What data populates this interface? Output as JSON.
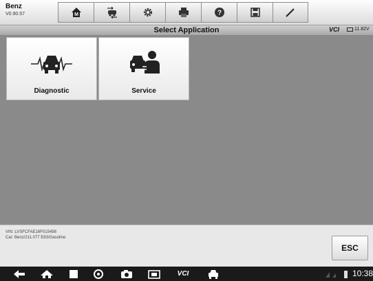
{
  "app": {
    "brand": "Benz",
    "version": "V0.90.57"
  },
  "toolbar": {
    "buttons": [
      {
        "icon": "home-icon"
      },
      {
        "icon": "vehicle-swap-icon"
      },
      {
        "icon": "settings-gear-icon"
      },
      {
        "icon": "print-icon"
      },
      {
        "icon": "help-icon"
      },
      {
        "icon": "save-icon"
      },
      {
        "icon": "pen-icon"
      }
    ]
  },
  "titlebar": {
    "title": "Select Application",
    "vci_label": "VCI",
    "battery_voltage": "11.82V"
  },
  "tiles": [
    {
      "label": "Diagnostic",
      "icon": "car-pulse-icon"
    },
    {
      "label": "Service",
      "icon": "car-mechanic-icon"
    }
  ],
  "info": {
    "vin": "VIN: LVSFCFAE16F015498",
    "car": "Car: Benz/211.077 E63/Gasoline"
  },
  "esc_label": "ESC",
  "navbar": {
    "vcl_label": "VCI",
    "time": "10:38"
  },
  "colors": {
    "work_area": "#8a8a8a",
    "nav_bg": "#1a1a1a"
  }
}
